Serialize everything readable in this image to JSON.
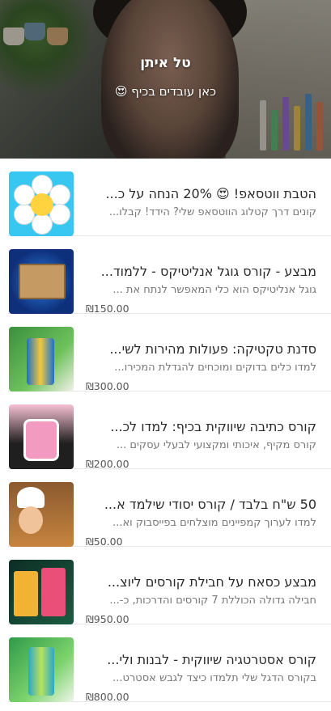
{
  "header": {
    "name": "טל איתן",
    "tagline": "כאן עובדים בכיף 😍"
  },
  "products": [
    {
      "title": "הטבת ווטסאפ! 😍 20% הנחה על כ...",
      "description": "קונים דרך קטלוג הווטסאפ שלי? הידד! קבלו...",
      "price": "",
      "thumb": "flower-emoji-image"
    },
    {
      "title": "מבצע - קורס גוגל אנליטיקס - ללמוד...",
      "description": "גוגל אנליטיקס הוא כלי המאפשר לנתח את ...",
      "price": "₪150.00",
      "thumb": "cardboard-box-image"
    },
    {
      "title": "סדנת טקטיקה: פעולות מהירות לשי...",
      "description": "למדו כלים בדוקים ומוכחים להגדלת המכירו...",
      "price": "₪300.00",
      "thumb": "energy-can-image"
    },
    {
      "title": "קורס כתיבה שיווקית בכיף: למדו לכ...",
      "description": "קורס מקיף, איכותי ומקצועי לבעלי עסקים ...",
      "price": "₪200.00",
      "thumb": "candy-jar-image"
    },
    {
      "title": "50 ש\"ח בלבד / קורס יסודי שילמד א...",
      "description": "למדו לערוך קמפיינים מוצלחים בפייסבוק וא...",
      "price": "₪50.00",
      "thumb": "chef-illustration-image"
    },
    {
      "title": "מבצע כסאח על חבילת קורסים ליוצ...",
      "description": "חבילה גדולה הכוללת 7 קורסים והדרכות, כ-...",
      "price": "₪950.00",
      "thumb": "snack-bags-image"
    },
    {
      "title": "קורס אסטרטגיה שיווקית - לבנות ולי...",
      "description": "בקורס הדגל שלי תלמדו כיצד לגבש אסטרט...",
      "price": "₪800.00",
      "thumb": "green-can-image"
    }
  ]
}
